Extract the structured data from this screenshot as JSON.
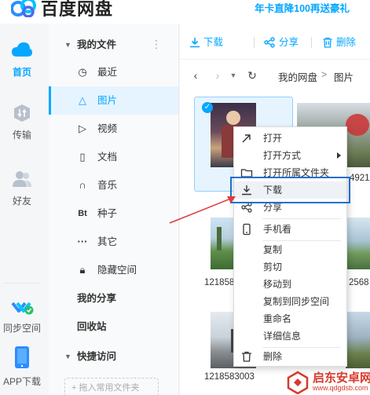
{
  "header": {
    "app_title": "百度网盘",
    "promo": "年卡直降100再送豪礼"
  },
  "rail": {
    "home": "首页",
    "transfer": "传输",
    "friends": "好友",
    "sync_space": "同步空间",
    "app_download": "APP下载"
  },
  "sidebar": {
    "my_files": "我的文件",
    "items": [
      "最近",
      "图片",
      "视频",
      "文档",
      "音乐",
      "种子",
      "其它",
      "隐藏空间"
    ],
    "my_share": "我的分享",
    "recycle": "回收站",
    "quick_access": "快捷访问",
    "add_quick": "+ 拖入常用文件夹"
  },
  "toolbar": {
    "download": "下载",
    "share": "分享",
    "delete": "删除"
  },
  "breadcrumb": {
    "root": "我的网盘",
    "sep": ">",
    "current": "图片"
  },
  "files": {
    "names": [
      "121858",
      "121858",
      "1218583003"
    ],
    "partial_right": [
      "4921",
      "2568"
    ]
  },
  "context_menu": {
    "items": [
      "打开",
      "打开方式",
      "打开所属文件夹",
      "下载",
      "分享",
      "手机看",
      "复制",
      "剪切",
      "移动到",
      "复制到同步空间",
      "重命名",
      "详细信息",
      "删除"
    ]
  },
  "watermark": {
    "title": "启东安卓网",
    "url": "www.qdgdsb.com"
  },
  "colors": {
    "accent": "#06a7ff",
    "highlight_box": "#1f6fd0",
    "arrow": "#e03a3a"
  }
}
